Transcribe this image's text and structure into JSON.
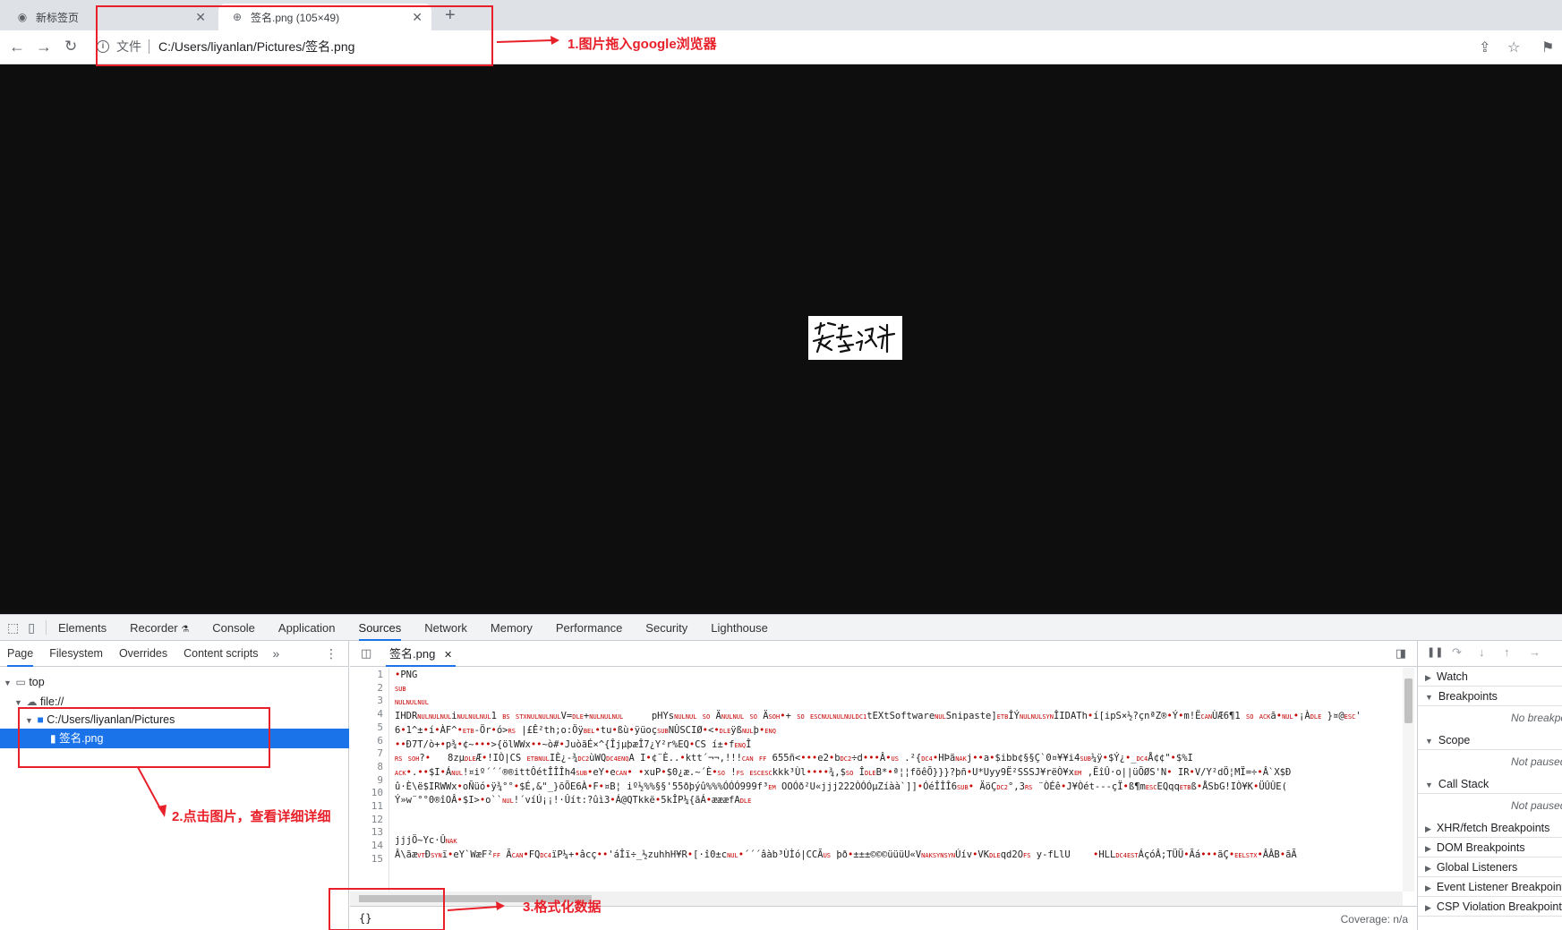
{
  "tabs": [
    {
      "title": "新标签页",
      "icon": "chrome-icon"
    },
    {
      "title": "",
      "icon": ""
    },
    {
      "title": "签名.png (105×49)",
      "icon": "globe-icon"
    }
  ],
  "toolbar": {
    "scheme_label": "文件",
    "url": "C:/Users/liyanlan/Pictures/签名.png"
  },
  "viewport": {
    "signature_text": "签名设计"
  },
  "devtools": {
    "main_tabs": [
      "Elements",
      "Recorder",
      "Console",
      "Application",
      "Sources",
      "Network",
      "Memory",
      "Performance",
      "Security",
      "Lighthouse"
    ],
    "selected_main_tab": "Sources",
    "navigator_tabs": [
      "Page",
      "Filesystem",
      "Overrides",
      "Content scripts"
    ],
    "tree": {
      "top": "top",
      "file": "file://",
      "folder": "C:/Users/liyanlan/Pictures",
      "selected_file": "签名.png"
    },
    "editor": {
      "open_file": "签名.png",
      "line_numbers": [
        "1",
        "2",
        "3",
        "4",
        "5",
        "6",
        "7",
        "8",
        "9",
        "10",
        "11",
        "12",
        "13",
        "14",
        "15"
      ],
      "lines": [
        "•PNG",
        "SUB",
        "NULNULNUL",
        "IHDRNULNULNULiNULNULNUL1 BS STXNULNULNULV=DLE+NULNULNUL     pHYsNULNUL SO ÄNULNUL SO ÄSOH•+ SO ESCNULNULNULDC1tEXtSoftwareNULSnipaste]ETBÎÝNULNULSYNÎIDATh•í[ipS×½?çnªZ®•Ý•m!ËCANÙÆ6¶1 SO ACKã•NUL•¡ÀDLE }¤@ESC'",
        "6•1^±•í•ÀF^•ETB-Ör•ó>RS |£Ê²th;o:ÖÿBEL•tu•ßù•ÿüoçSUBNÛSCIØ•<•DLEÿßNULþ•ENQ",
        "••Ð7T/ò+•p¾•¢~•••>{ölWWx••~ò#•JuòãÉ×^{ÎjµþæÎ7¿Y²r%EQ•CS í±•fENQÎ",
        "RS SOH?•   8zµDLEÆ•!IÒ|CS ETBNULIÈ¿-¾DC2ùWQDC4ENQA I•¢¨È..•ktt´¬¬,!!!CAN FF 655ñ<•••e2•bDC2÷d•••Â•US .²{DC4•HÞãNAKj••a•$ibb¢§§Ç`0¤¥¥i4SUB¼ÿ•$Ý¿•_DC4Å¢¢\"•$%I",
        "ACK•.••$I•ÁNUL!¤iº´´´®®ittÔétÎÎÎh4SUB•eY•eCAN• •xuP•$0¿æ.~´È•SO !FS ESCESCkkk³Ùl••••¾,$SO ÎDLEB*•ª¦¦fõêÕ}}}?þñ•U*Uyy9Ë²SSSJ¥rëÒ¥xEM ,ËîÛ·o||üÕØS'N• IR•V/Y²dÖ¦MÏ=÷•Â`X$Ð",
        "û·È\\ë$IRWWx•oÑüó•ÿ¾°°•$É,&\"_}õÕE6À•F•¤B¦ iº½%%§§'55ðþýû%%%ÓÓÓ999f³EM OOÓð²U«jjj222ÒÓÓµZíàà`]]•ÓéÎÎÎ6SUB• ÄöÇDC2°,3RS ¨ÒÉê•J¥Òét---çÏ•ß¶mESCEQqqETBß•ÅSbG!IÒ¥K•ÜÛÛE(",
        "Ý»w¨°°0®îOÂ•$I>•o``NUL!´víÚ¡¡!·Ûít:?ûì3•Á@QTkkë•5kÎP¼{ãÁ•æææfADLE",
        "",
        "",
        "jjjÖ~Yc·ÛNAK",
        "Â\\ãæVTÐSYNï•eY`WæF²FF ÃCAN•FQDC4ïP¼+•âcç••'áÎï÷_½zuhhH¥R•[·î0±cNUL•´´´âàb³ÙÌó|CCÃUS þð•±±±©©©üüüU«VNAKSYNSYNÚív•VKDLEqd2OFS y-fLlU    •HLLDC4ESTÁçóÂ;TÜÜ•Ãá•••ãÇ•EELSTX•ÂÂB•ãÃ",
        ""
      ],
      "status_coverage": "Coverage: n/a",
      "format_button": "{}"
    },
    "debugger_sections": [
      {
        "label": "Watch",
        "open": false
      },
      {
        "label": "Breakpoints",
        "open": true,
        "message": "No breakpoints"
      },
      {
        "label": "Scope",
        "open": true,
        "message": "Not paused"
      },
      {
        "label": "Call Stack",
        "open": true,
        "message": "Not paused"
      },
      {
        "label": "XHR/fetch Breakpoints",
        "open": false
      },
      {
        "label": "DOM Breakpoints",
        "open": false
      },
      {
        "label": "Global Listeners",
        "open": false
      },
      {
        "label": "Event Listener Breakpoints",
        "open": false
      },
      {
        "label": "CSP Violation Breakpoints",
        "open": false
      }
    ]
  },
  "annotations": [
    "1.图片拖入google浏览器",
    "2.点击图片，查看详细详细",
    "3.格式化数据"
  ],
  "colors": {
    "annotation": "#e8202a",
    "selection": "#1a73e8",
    "viewport_bg": "#0e0e0e"
  }
}
